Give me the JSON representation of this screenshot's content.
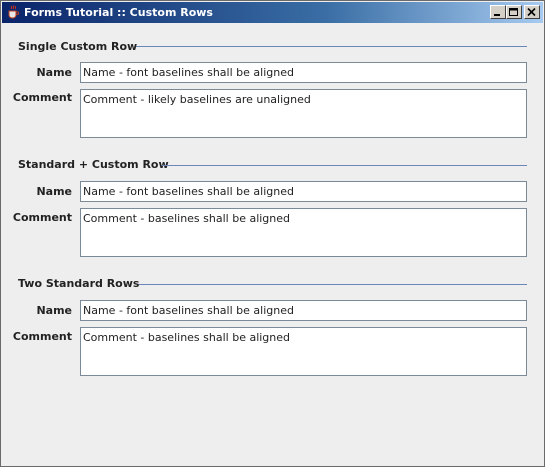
{
  "window": {
    "title": "Forms Tutorial :: Custom Rows",
    "icon": "java-cup-icon",
    "buttons": [
      "minimize-icon",
      "maximize-icon",
      "close-icon"
    ]
  },
  "sections": [
    {
      "title": "Single Custom Row",
      "name_label": "Name",
      "name_value": "Name - font baselines shall be aligned",
      "comment_label": "Comment",
      "comment_value": "Comment - likely baselines are unaligned"
    },
    {
      "title": "Standard + Custom Row",
      "name_label": "Name",
      "name_value": "Name - font baselines shall be aligned",
      "comment_label": "Comment",
      "comment_value": "Comment - baselines shall be aligned"
    },
    {
      "title": "Two Standard Rows",
      "name_label": "Name",
      "name_value": "Name - font baselines shall be aligned",
      "comment_label": "Comment",
      "comment_value": "Comment - baselines shall be aligned"
    }
  ],
  "colors": {
    "separator": "#6b86b8",
    "titlebar_start": "#0a246a",
    "titlebar_end": "#a6caf0"
  }
}
